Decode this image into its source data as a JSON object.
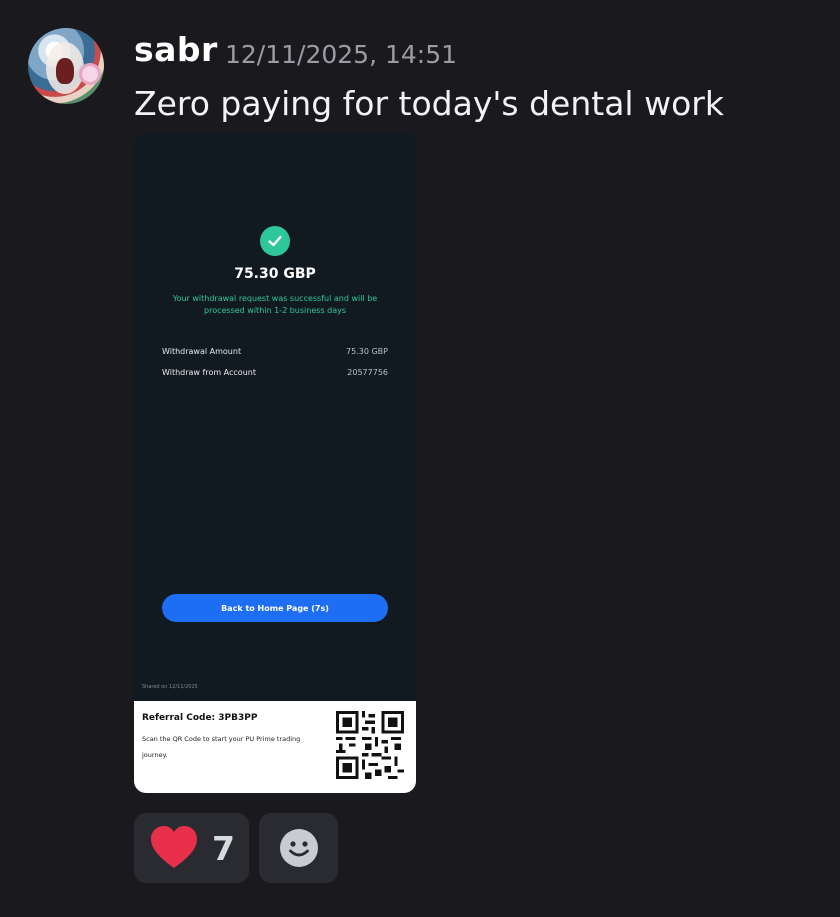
{
  "message": {
    "author": "sabr",
    "timestamp": "12/11/2025, 14:51",
    "text": "Zero paying for today's dental work"
  },
  "receipt": {
    "amount": "75.30 GBP",
    "note": "Your withdrawal request was successful and will be processed within 1-2 business days",
    "rows": [
      {
        "label": "Withdrawal Amount",
        "value": "75.30 GBP"
      },
      {
        "label": "Withdraw from Account",
        "value": "20577756"
      }
    ],
    "button": "Back to Home Page (7s)",
    "shared": "Shared on 12/11/2025",
    "referral_title": "Referral Code: 3PB3PP",
    "referral_text": "Scan the QR Code to start your PU Prime trading journey.",
    "accent": "#2ec79a",
    "button_color": "#1d6ef2"
  },
  "reactions": [
    {
      "icon": "heart-icon",
      "count": "7"
    },
    {
      "icon": "add-reaction-icon"
    }
  ]
}
